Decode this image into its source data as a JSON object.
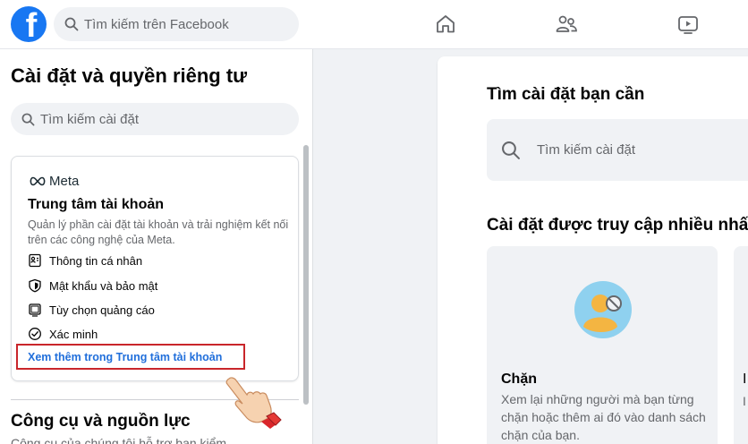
{
  "topbar": {
    "logo": "f",
    "search_placeholder": "Tìm kiếm trên Facebook",
    "nav_icons": [
      "home-icon",
      "friends-icon",
      "watch-icon"
    ]
  },
  "sidebar": {
    "title": "Cài đặt và quyền riêng tư",
    "search_placeholder": "Tìm kiếm cài đặt",
    "account_center": {
      "brand": "Meta",
      "title": "Trung tâm tài khoản",
      "description": "Quản lý phần cài đặt tài khoản và trải nghiệm kết nối trên các công nghệ của Meta.",
      "items": [
        {
          "label": "Thông tin cá nhân",
          "icon": "id-card-icon"
        },
        {
          "label": "Mật khẩu và bảo mật",
          "icon": "shield-icon"
        },
        {
          "label": "Tùy chọn quảng cáo",
          "icon": "ad-preferences-icon"
        },
        {
          "label": "Xác minh",
          "icon": "verified-check-icon"
        }
      ],
      "link": "Xem thêm trong Trung tâm tài khoản"
    },
    "tools": {
      "title": "Công cụ và nguồn lực",
      "description": "Công cụ của chúng tôi hỗ trợ bạn kiểm"
    }
  },
  "main": {
    "search_title": "Tìm cài đặt bạn cần",
    "search_placeholder": "Tìm kiếm cài đặt",
    "frequent_title": "Cài đặt được truy cập nhiều nhấ",
    "tiles": [
      {
        "title": "Chặn",
        "description": "Xem lại những người mà bạn từng chặn hoặc thêm ai đó vào danh sách chặn của bạn.",
        "icon": "blocked-person-icon"
      }
    ],
    "second_tile_title_fragment": "I",
    "second_tile_desc_fragment": "I"
  },
  "colors": {
    "brand_blue": "#1877f2",
    "link_blue": "#216fdb",
    "highlight_red": "#c9262b",
    "background": "#f0f2f5"
  }
}
